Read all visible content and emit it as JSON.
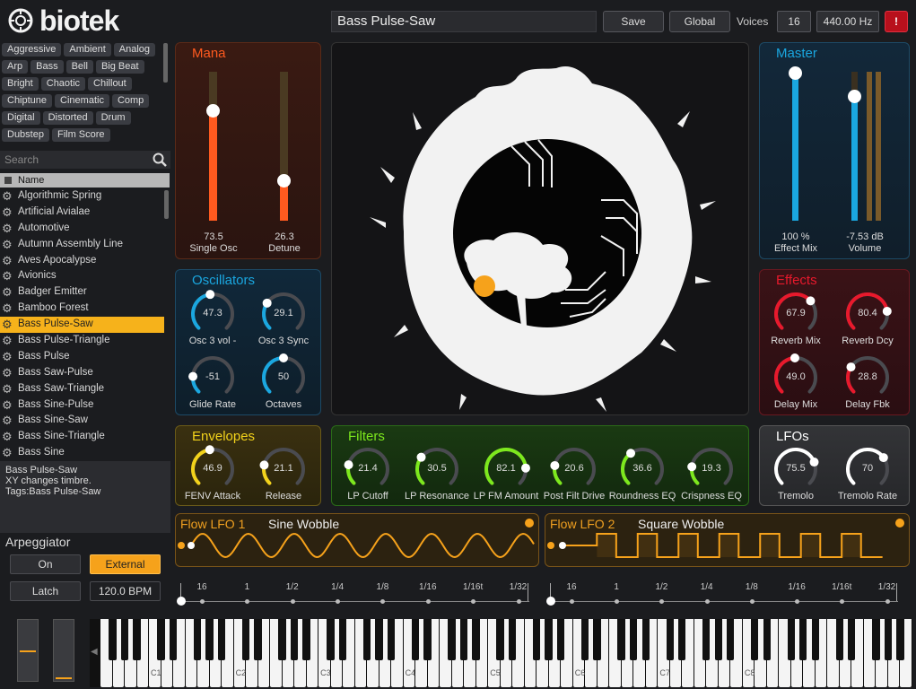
{
  "header": {
    "logo_text": "biotek",
    "preset_name": "Bass Pulse-Saw",
    "save_label": "Save",
    "global_label": "Global",
    "voices_label": "Voices",
    "voices_value": "16",
    "tuning_value": "440.00 Hz",
    "alert_label": "!"
  },
  "browser": {
    "tags": [
      "Aggressive",
      "Ambient",
      "Analog",
      "Arp",
      "Bass",
      "Bell",
      "Big Beat",
      "Bright",
      "Chaotic",
      "Chillout",
      "Chiptune",
      "Cinematic",
      "Comp",
      "Digital",
      "Distorted",
      "Drum",
      "Dubstep",
      "Film Score"
    ],
    "search_placeholder": "Search",
    "column_header": "Name",
    "presets": [
      "Algorithmic Spring",
      "Artificial Avialae",
      "Automotive",
      "Autumn Assembly Line",
      "Aves Apocalypse",
      "Avionics",
      "Badger Emitter",
      "Bamboo Forest",
      "Bass Pulse-Saw",
      "Bass Pulse-Triangle",
      "Bass Pulse",
      "Bass Saw-Pulse",
      "Bass Saw-Triangle",
      "Bass Sine-Pulse",
      "Bass Sine-Saw",
      "Bass Sine-Triangle",
      "Bass Sine"
    ],
    "selected_index": 8,
    "info_line1": "Bass Pulse-Saw",
    "info_line2": "XY changes timbre.",
    "info_line3": "Tags:Bass Pulse-Saw"
  },
  "arpeggiator": {
    "title": "Arpeggiator",
    "on_label": "On",
    "external_label": "External",
    "latch_label": "Latch",
    "bpm_value": "120.0 BPM"
  },
  "mana": {
    "title": "Mana",
    "sliders": [
      {
        "value": "73.5",
        "label": "Single Osc",
        "level": 0.735
      },
      {
        "value": "26.3",
        "label": "Detune",
        "level": 0.263
      }
    ]
  },
  "master": {
    "title": "Master",
    "effect_mix_value": "100 %",
    "effect_mix_label": "Effect Mix",
    "effect_mix_level": 1.0,
    "volume_value": "-7.53 dB",
    "volume_label": "Volume",
    "volume_level": 0.83
  },
  "oscillators": {
    "title": "Oscillators",
    "knobs": [
      {
        "value": "47.3",
        "label": "Osc 3 vol -",
        "level": 0.473
      },
      {
        "value": "29.1",
        "label": "Osc 3 Sync",
        "level": 0.291
      },
      {
        "value": "-51",
        "label": "Glide Rate",
        "level": 0.18
      },
      {
        "value": "50",
        "label": "Octaves",
        "level": 0.5
      }
    ]
  },
  "effects": {
    "title": "Effects",
    "knobs": [
      {
        "value": "67.9",
        "label": "Reverb Mix",
        "level": 0.679
      },
      {
        "value": "80.4",
        "label": "Reverb Dcy",
        "level": 0.804
      },
      {
        "value": "49.0",
        "label": "Delay Mix",
        "level": 0.49
      },
      {
        "value": "28.8",
        "label": "Delay Fbk",
        "level": 0.288
      }
    ]
  },
  "envelopes": {
    "title": "Envelopes",
    "knobs": [
      {
        "value": "46.9",
        "label": "FENV Attack",
        "level": 0.469
      },
      {
        "value": "21.1",
        "label": "Release",
        "level": 0.211
      }
    ]
  },
  "filters": {
    "title": "Filters",
    "knobs": [
      {
        "value": "21.4",
        "label": "LP Cutoff",
        "level": 0.214
      },
      {
        "value": "30.5",
        "label": "LP Resonance",
        "level": 0.305
      },
      {
        "value": "82.1",
        "label": "LP FM Amount",
        "level": 0.821
      },
      {
        "value": "20.6",
        "label": "Post Filt Drive",
        "level": 0.206
      },
      {
        "value": "36.6",
        "label": "Roundness EQ",
        "level": 0.366
      },
      {
        "value": "19.3",
        "label": "Crispness EQ",
        "level": 0.193
      }
    ]
  },
  "lfos": {
    "title": "LFOs",
    "knobs": [
      {
        "value": "75.5",
        "label": "Tremolo",
        "level": 0.755
      },
      {
        "value": "70",
        "label": "Tremolo Rate",
        "level": 0.7
      }
    ]
  },
  "flow_lfos": [
    {
      "title": "Flow LFO 1",
      "name": "Sine Wobble"
    },
    {
      "title": "Flow LFO 2",
      "name": "Square Wobble"
    }
  ],
  "rate_ticks": [
    "16",
    "1",
    "1/2",
    "1/4",
    "1/8",
    "1/16",
    "1/16t",
    "1/32"
  ],
  "keyboard": {
    "octave_labels": [
      "C1",
      "C2",
      "C3",
      "C4",
      "C5",
      "C6",
      "C7",
      "C8"
    ]
  },
  "colors": {
    "accent_orange": "#f6a21b",
    "mana_red": "#ff5a1f",
    "master_blue": "#1aa7e0",
    "effects_red": "#e8192c",
    "env_yellow": "#f2d21b",
    "filter_green": "#7de81d",
    "lfo_white": "#ffffff"
  }
}
